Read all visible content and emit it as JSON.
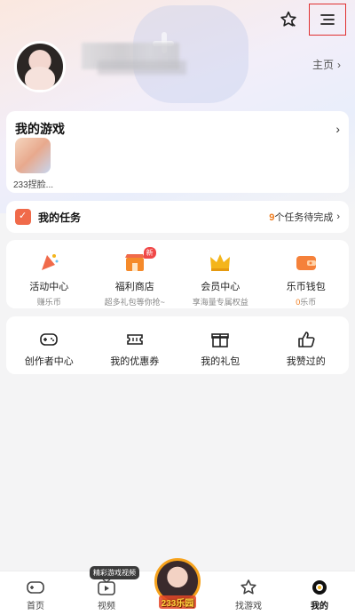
{
  "header": {
    "home_link": "主页"
  },
  "my_games": {
    "title": "我的游戏",
    "items": [
      {
        "label": "233捏脸..."
      }
    ]
  },
  "tasks": {
    "title": "我的任务",
    "count": "9",
    "suffix": "个任务待完成"
  },
  "services": [
    {
      "title": "活动中心",
      "sub": "赚乐币",
      "icon": "party-icon",
      "color": "#f06a4a"
    },
    {
      "title": "福利商店",
      "sub": "超多礼包等你抢~",
      "icon": "shop-icon",
      "color": "#f58a2a",
      "badge": "新"
    },
    {
      "title": "会员中心",
      "sub": "享海量专属权益",
      "icon": "crown-icon",
      "color": "#f4b51b"
    },
    {
      "title": "乐币钱包",
      "sub_count": "0",
      "sub": "乐币",
      "icon": "wallet-icon",
      "color": "#f5813a"
    }
  ],
  "tools": [
    {
      "label": "创作者中心",
      "icon": "gamepad-icon"
    },
    {
      "label": "我的优惠券",
      "icon": "coupon-icon"
    },
    {
      "label": "我的礼包",
      "icon": "gift-icon"
    },
    {
      "label": "我赞过的",
      "icon": "thumbs-up-icon"
    }
  ],
  "bottom_nav": {
    "home": "首页",
    "video": "视频",
    "video_tag": "精彩游戏视频",
    "center": "233乐园",
    "find_games": "找游戏",
    "mine": "我的"
  },
  "colors": {
    "accent_orange": "#f07c1e",
    "menu_highlight": "#e03030"
  }
}
